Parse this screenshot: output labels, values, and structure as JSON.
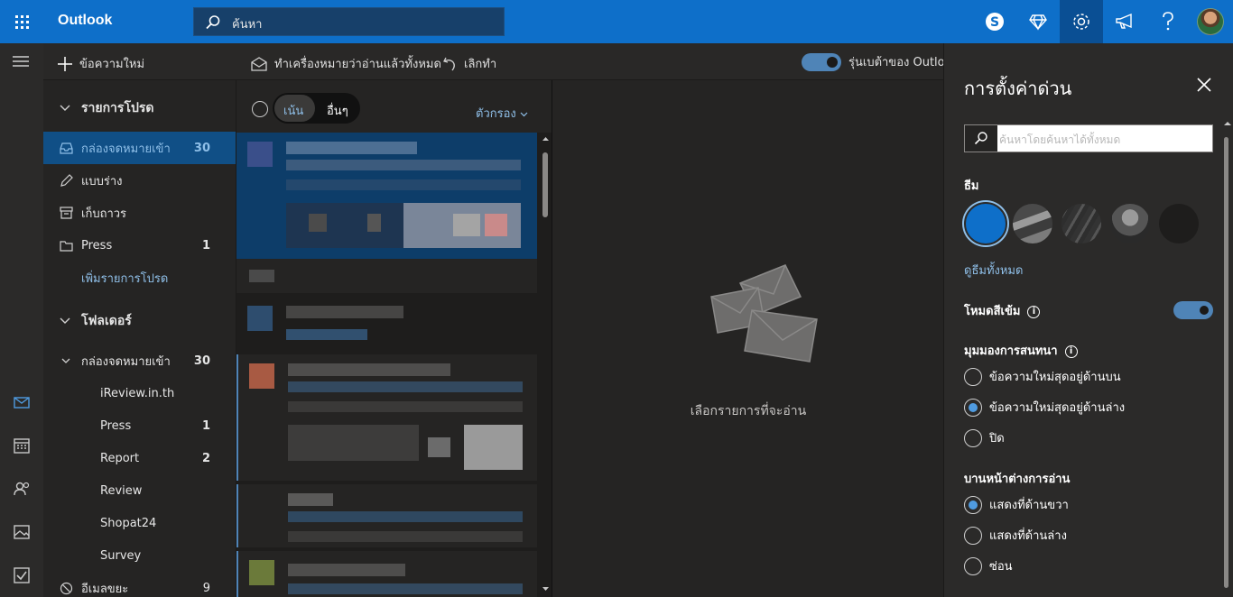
{
  "topbar": {
    "brand": "Outlook",
    "search_placeholder": "ค้นหา",
    "icons": [
      "waffle-icon",
      "skype-icon",
      "diamond-icon",
      "gear-icon",
      "megaphone-icon",
      "help-icon",
      "avatar"
    ]
  },
  "command_bar": {
    "new_message": "ข้อความใหม่",
    "mark_all_read": "ทำเครื่องหมายว่าอ่านแล้วทั้งหมด",
    "undo": "เลิกทำ",
    "beta_label": "รุ่นเบต้าของ Outlook"
  },
  "folders": {
    "favorites_header": "รายการโปรด",
    "favorites": [
      {
        "label": "กล่องจดหมายเข้า",
        "count": "30"
      },
      {
        "label": "แบบร่าง",
        "count": ""
      },
      {
        "label": "เก็บถาวร",
        "count": ""
      },
      {
        "label": "Press",
        "count": "1"
      }
    ],
    "add_favorite": "เพิ่มรายการโปรด",
    "folders_header": "โฟลเดอร์",
    "inbox": {
      "label": "กล่องจดหมายเข้า",
      "count": "30"
    },
    "subfolders": [
      {
        "label": "iReview.in.th",
        "count": ""
      },
      {
        "label": "Press",
        "count": "1"
      },
      {
        "label": "Report",
        "count": "2"
      },
      {
        "label": "Review",
        "count": ""
      },
      {
        "label": "Shopat24",
        "count": ""
      },
      {
        "label": "Survey",
        "count": ""
      }
    ],
    "junk": {
      "label": "อีเมลขยะ",
      "count": "9"
    }
  },
  "message_list": {
    "focused_tab": "เน้น",
    "other_tab": "อื่นๆ",
    "filter_label": "ตัวกรอง"
  },
  "reading_pane": {
    "empty_message": "เลือกรายการที่จะอ่าน"
  },
  "settings": {
    "title": "การตั้งค่าด่วน",
    "search_placeholder": "ค้นหาโดยค้นหาได้ทั้งหมด",
    "theme_label": "ธีม",
    "view_all_themes": "ดูธีมทั้งหมด",
    "dark_mode_label": "โหมดสีเข้ม",
    "dark_mode_on": true,
    "conversation_view_label": "มุมมองการสนทนา",
    "conversation_options": [
      {
        "label": "ข้อความใหม่สุดอยู่ด้านบน",
        "selected": false
      },
      {
        "label": "ข้อความใหม่สุดอยู่ด้านล่าง",
        "selected": true
      },
      {
        "label": "ปิด",
        "selected": false
      }
    ],
    "reading_pane_label": "บานหน้าต่างการอ่าน",
    "reading_pane_options": [
      {
        "label": "แสดงที่ด้านขวา",
        "selected": true
      },
      {
        "label": "แสดงที่ด้านล่าง",
        "selected": false
      },
      {
        "label": "ซ่อน",
        "selected": false
      }
    ]
  },
  "colors": {
    "accent": "#0e6fc9",
    "selected_folder": "#104f86",
    "link": "#8fbfe8"
  }
}
